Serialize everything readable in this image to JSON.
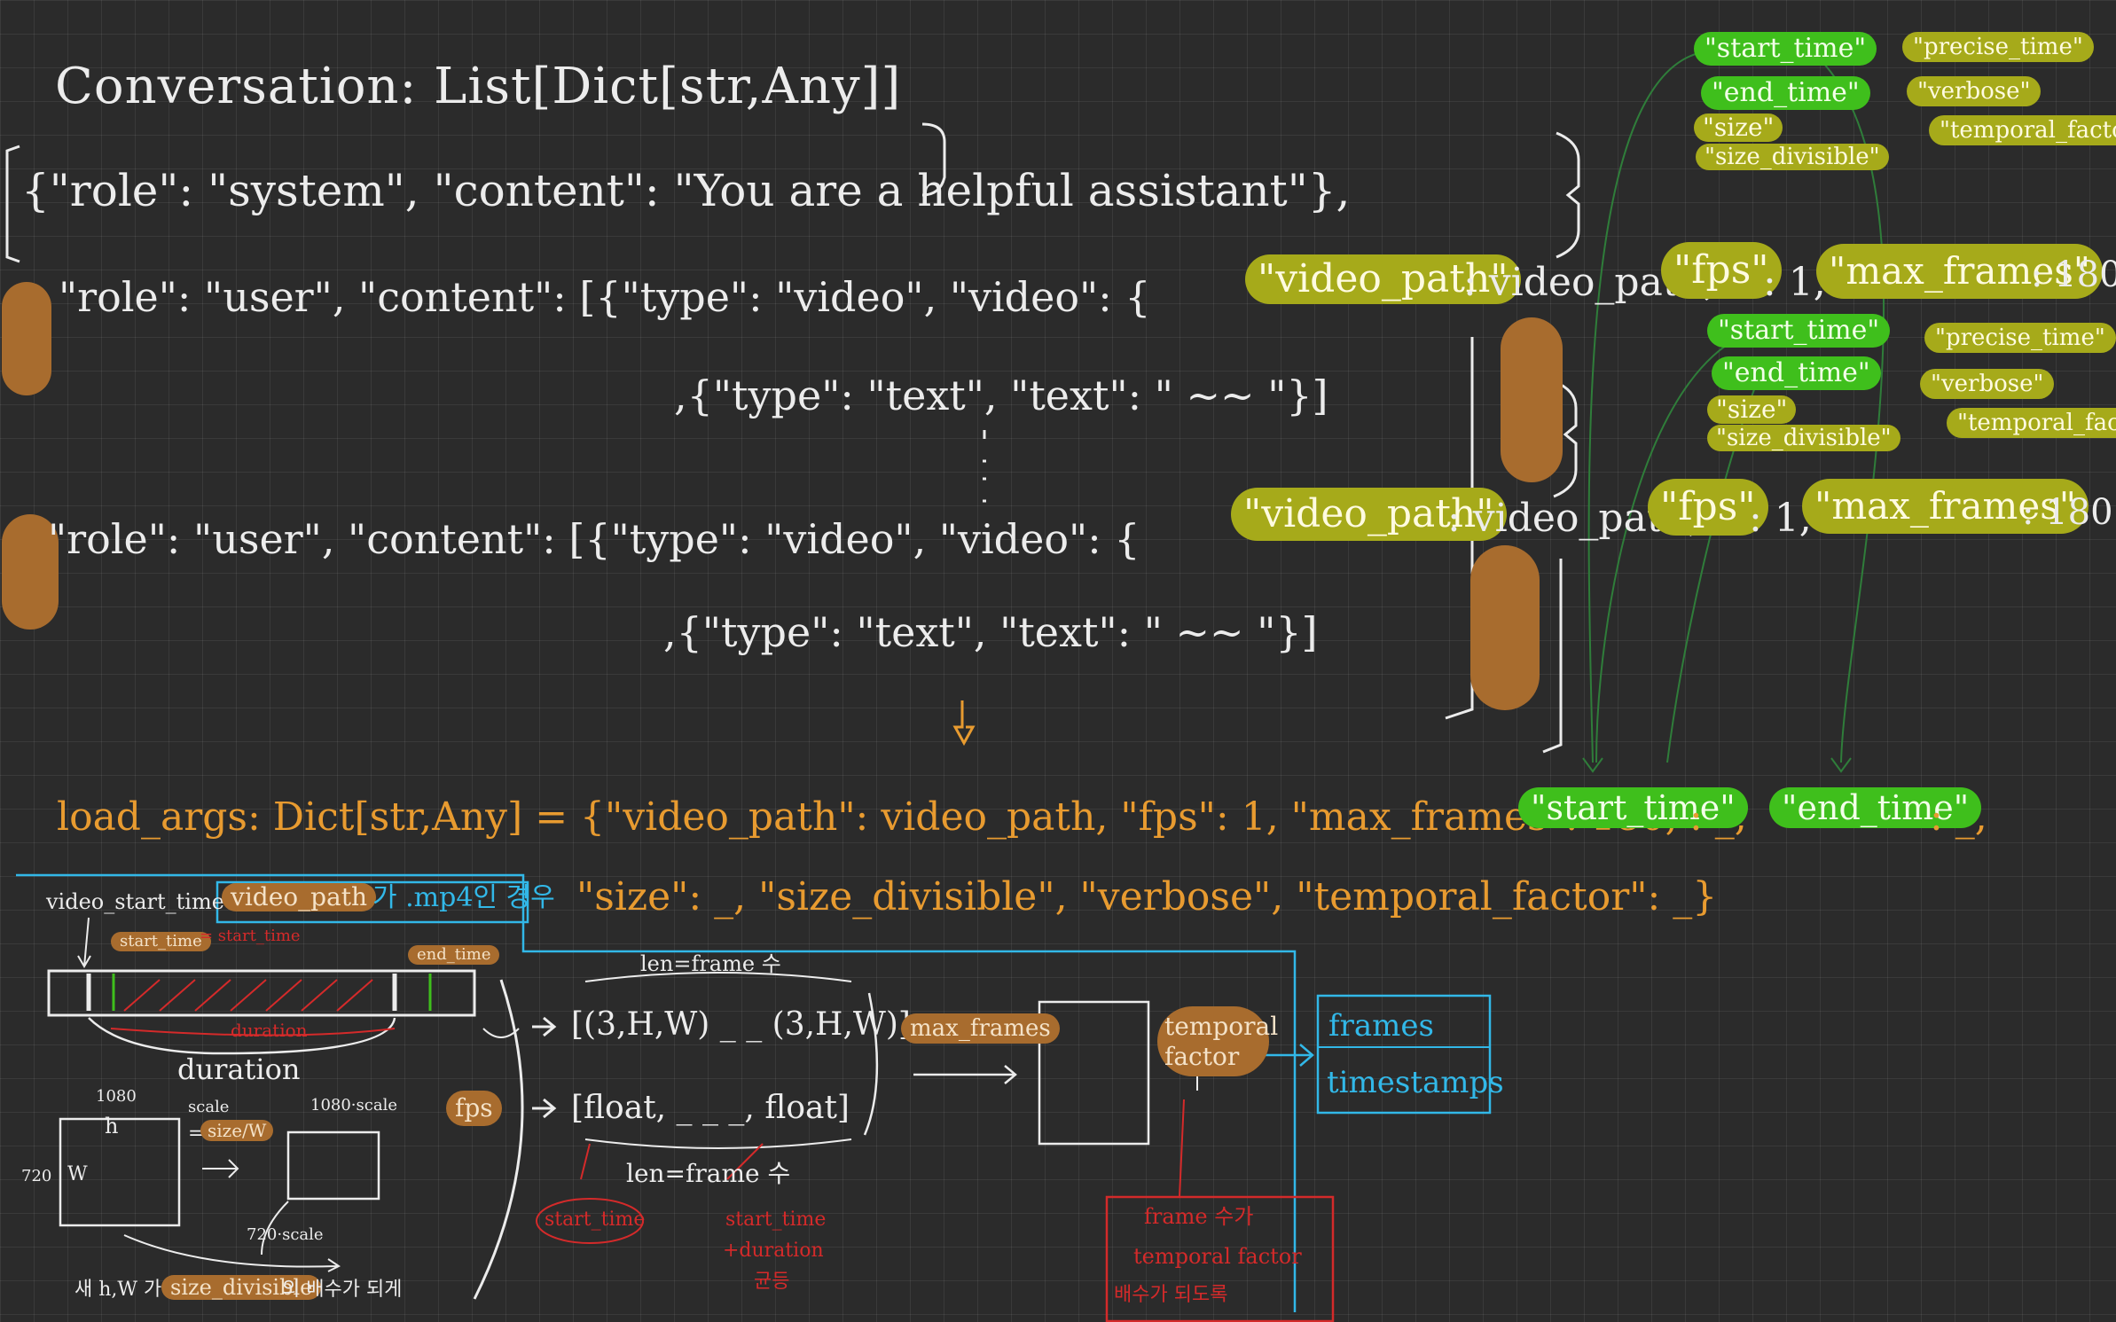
{
  "header": {
    "signature": "Conversation: List[Dict[str,Any]]"
  },
  "conversation": {
    "system_line": "{\"role\": \"system\", \"content\": \"You are a helpful assistant\"},",
    "user1": {
      "prefix": "\"role\": \"user\", \"content\": [{\"type\": \"video\", \"video\": {",
      "video_path_key": "\"video_path\"",
      "video_path_val": ": video_path,",
      "fps_key": "\"fps\"",
      "fps_val": ": 1,",
      "max_frames_key": "\"max_frames\"",
      "max_frames_val": ": 180",
      "text_line": ",{\"type\": \"text\", \"text\": \" ~~ \"}]"
    },
    "user2": {
      "prefix": "\"role\": \"user\", \"content\": [{\"type\": \"video\", \"video\": {",
      "video_path_key": "\"video_path\"",
      "video_path_val": ": video_path,",
      "fps_key": "\"fps\"",
      "fps_val": ": 1,",
      "max_frames_key": "\"max_frames\"",
      "max_frames_val": ": 180",
      "text_line": ",{\"type\": \"text\", \"text\": \" ~~ \"}]"
    }
  },
  "option_keys_top": {
    "green": [
      "\"start_time\"",
      "\"end_time\""
    ],
    "olive": [
      "\"size\"",
      "\"size_divisible\""
    ],
    "right": [
      "\"precise_time\"",
      "\"verbose\"",
      "\"temporal_factor\""
    ]
  },
  "option_keys_mid": {
    "green": [
      "\"start_time\"",
      "\"end_time\""
    ],
    "olive": [
      "\"size\"",
      "\"size_divisible\""
    ],
    "right": [
      "\"precise_time\"",
      "\"verbose\"",
      "\"temporal_factor\""
    ]
  },
  "load_args": {
    "line1": "load_args: Dict[str,Any] = {\"video_path\": video_path, \"fps\": 1, \"max_frames\": 180,",
    "start_time": "\"start_time\"",
    "sep1": ": _,",
    "end_time": "\"end_time\"",
    "sep2": ": _,",
    "line2": "\"size\": _, \"size_divisible\", \"verbose\", \"temporal_factor\": _}"
  },
  "diagram": {
    "video_start_time": "video_start_time",
    "note_label": "video_path",
    "note_text": "가 .mp4인 경우",
    "start_time_tag": "start_time",
    "start_time_red": "= start_time",
    "end_time_tag": "end_time",
    "duration_red": "duration",
    "duration": "duration",
    "h_top": "1080",
    "h": "h",
    "w_side": "720",
    "w": "W",
    "scale": "scale",
    "scale_eq": "=",
    "size_over_w": "size/W",
    "h_scaled": "1080·scale",
    "w_scaled": "720·scale",
    "bottom_note_pre": "새 h,W 가",
    "bottom_note_tag": "size_divisible",
    "bottom_note_post": "의 배수가 되게",
    "fps": "fps",
    "len_frame_top": "len=frame 수",
    "frames_array": "[(3,H,W) _ _ (3,H,W)]",
    "float_array": "[float, _ _ _, float]",
    "len_frame_bottom": "len=frame 수",
    "start_time_circle": "start_time",
    "red_note_1": "start_time",
    "red_note_2": "+duration",
    "red_note_3": "균등",
    "max_frames": "max_frames",
    "temporal_factor": "temporal factor",
    "red_box_1": "frame 수가",
    "red_box_2": "temporal factor",
    "red_box_3": "배수가 되도록",
    "out_frames": "frames",
    "out_timestamps": "timestamps"
  },
  "colors": {
    "white": "#ececec",
    "orange": "#e89b30",
    "cyan": "#32b8e8",
    "red": "#d42a2a",
    "green": "#3fbf1c",
    "olive": "#a6aa1a",
    "brown": "#a86c2e"
  }
}
